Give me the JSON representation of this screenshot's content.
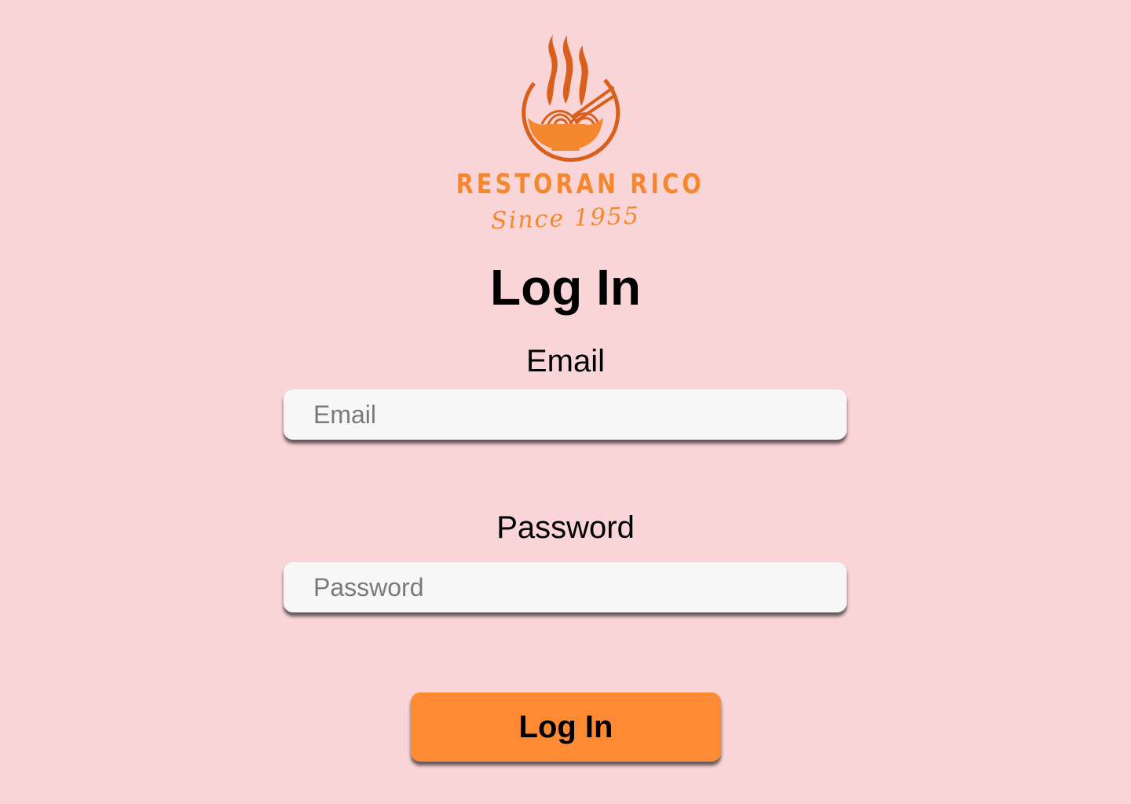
{
  "brand": {
    "name": "RESTORAN RICO",
    "tagline": "Since 1955",
    "logo_icon": "noodle-bowl-with-steam-and-chopsticks",
    "primary_color": "#d9601c",
    "accent_color": "#f5882e"
  },
  "page": {
    "title": "Log In",
    "background_color": "#f9d5d7"
  },
  "form": {
    "email": {
      "label": "Email",
      "placeholder": "Email",
      "value": ""
    },
    "password": {
      "label": "Password",
      "placeholder": "Password",
      "value": ""
    },
    "submit_label": "Log In",
    "submit_color": "#fe8a33"
  }
}
